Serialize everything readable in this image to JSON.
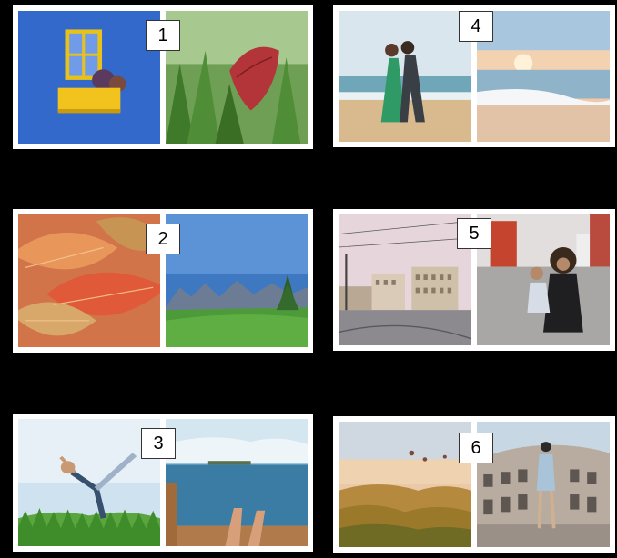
{
  "panels": [
    {
      "number": "1",
      "left_photo": "blue-wall-window-photo",
      "right_photo": "red-leaf-grass-photo"
    },
    {
      "number": "2",
      "left_photo": "autumn-leaves-photo",
      "right_photo": "green-meadow-mountains-photo"
    },
    {
      "number": "3",
      "left_photo": "yoga-pose-photo",
      "right_photo": "feet-by-lake-photo"
    },
    {
      "number": "4",
      "left_photo": "couple-on-beach-photo",
      "right_photo": "sunset-beach-photo"
    },
    {
      "number": "5",
      "left_photo": "city-square-photo",
      "right_photo": "mother-child-street-photo"
    },
    {
      "number": "6",
      "left_photo": "hot-air-balloons-photo",
      "right_photo": "colosseum-woman-photo"
    }
  ]
}
